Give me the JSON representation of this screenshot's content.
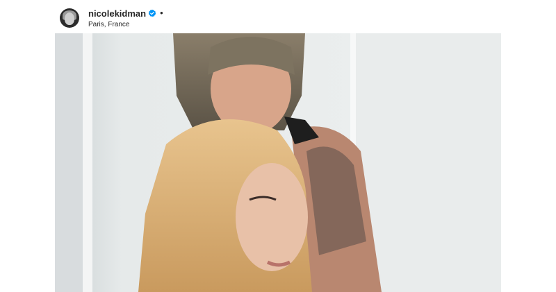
{
  "post": {
    "username": "nicolekidman",
    "separator": "•",
    "location": "Paris, France",
    "verified": true
  },
  "icons": {
    "avatar": "profile-avatar",
    "verified": "verified-badge-icon"
  },
  "colors": {
    "verified_blue": "#0095f6",
    "text": "#262626",
    "background": "#ffffff"
  }
}
